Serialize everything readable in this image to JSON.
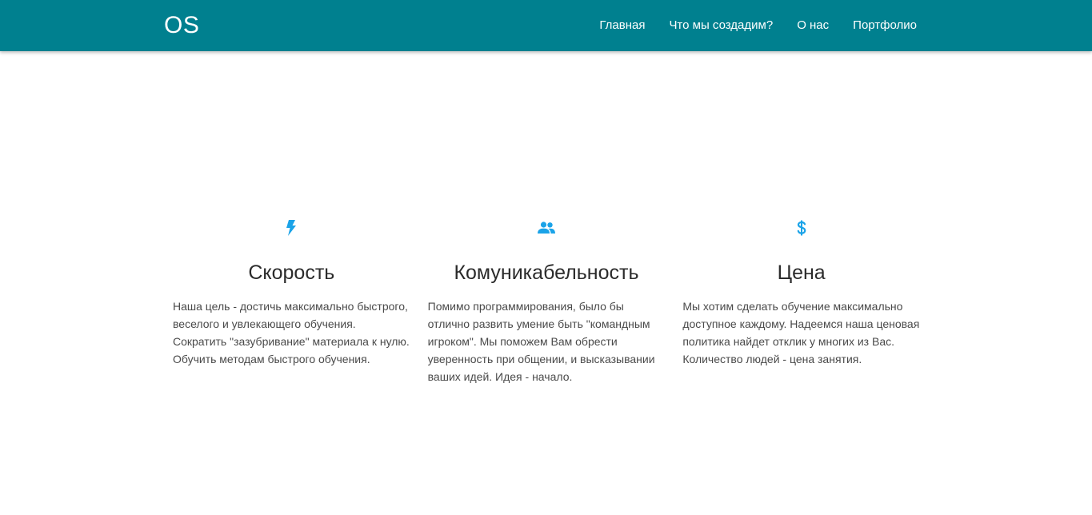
{
  "navbar": {
    "brand": "OS",
    "links": [
      {
        "label": "Главная"
      },
      {
        "label": "Что мы создадим?"
      },
      {
        "label": "О нас"
      },
      {
        "label": "Портфолио"
      }
    ],
    "background": "#00808f"
  },
  "features": [
    {
      "icon": "bolt-icon",
      "title": "Скорость",
      "text": "Наша цель - достичь максимально быстрого, веселого и увлекающего обучения. Сократить \"зазубривание\" материала к нулю. Обучить методам быстрого обучения."
    },
    {
      "icon": "people-icon",
      "title": "Комуникабельность",
      "text": "Помимо программирования, было бы отлично развить умение быть \"командным игроком\". Мы поможем Вам обрести уверенность при общении, и высказывании ваших идей. Идея - начало."
    },
    {
      "icon": "dollar-icon",
      "title": "Цена",
      "text": "Мы хотим сделать обучение максимально доступное каждому. Надеемся наша ценовая политика найдет отклик у многих из Вас. Количество людей - цена занятия."
    }
  ],
  "colors": {
    "accent": "#00808f",
    "icon": "#1aa3e8"
  }
}
